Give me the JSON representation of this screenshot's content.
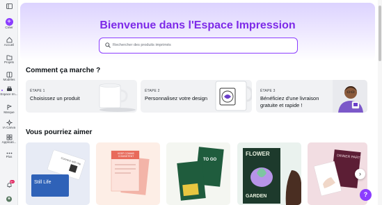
{
  "sidebar": {
    "create_label": "Créer",
    "items": [
      {
        "label": "Accueil"
      },
      {
        "label": "Projets"
      },
      {
        "label": "Modèles"
      },
      {
        "label": "Espace Im..."
      },
      {
        "label": "Marque"
      },
      {
        "label": "IA Canva"
      },
      {
        "label": "Applicati..."
      },
      {
        "label": "Plus"
      }
    ],
    "notification_count": "9+"
  },
  "hero": {
    "title": "Bienvenue dans l'Espace Impression",
    "search_placeholder": "Rechercher des produits imprimés"
  },
  "how_it_works": {
    "title": "Comment ça marche ?",
    "steps": [
      {
        "tag": "ÉTAPE 1",
        "text": "Choisissez un produit"
      },
      {
        "tag": "ÉTAPE 2",
        "text": "Personnalisez votre design"
      },
      {
        "tag": "ÉTAPE 3",
        "text": "Bénéficiez d'une livraison gratuite et rapide !"
      }
    ]
  },
  "recommendations": {
    "title": "Vous pourriez aimer",
    "cards": [
      {
        "art_text": "Still Life",
        "art_subtext": "Connect with me"
      },
      {
        "art_text": "KEEP COMMS CONSISTENT"
      },
      {
        "art_text": "TO GO"
      },
      {
        "art_text": "FLOWER",
        "art_subtext": "GARDEN"
      },
      {
        "art_text": "DINNER PARTY"
      }
    ]
  },
  "help_label": "?",
  "colors": {
    "accent": "#8b3dff",
    "title": "#7d2ae8"
  }
}
